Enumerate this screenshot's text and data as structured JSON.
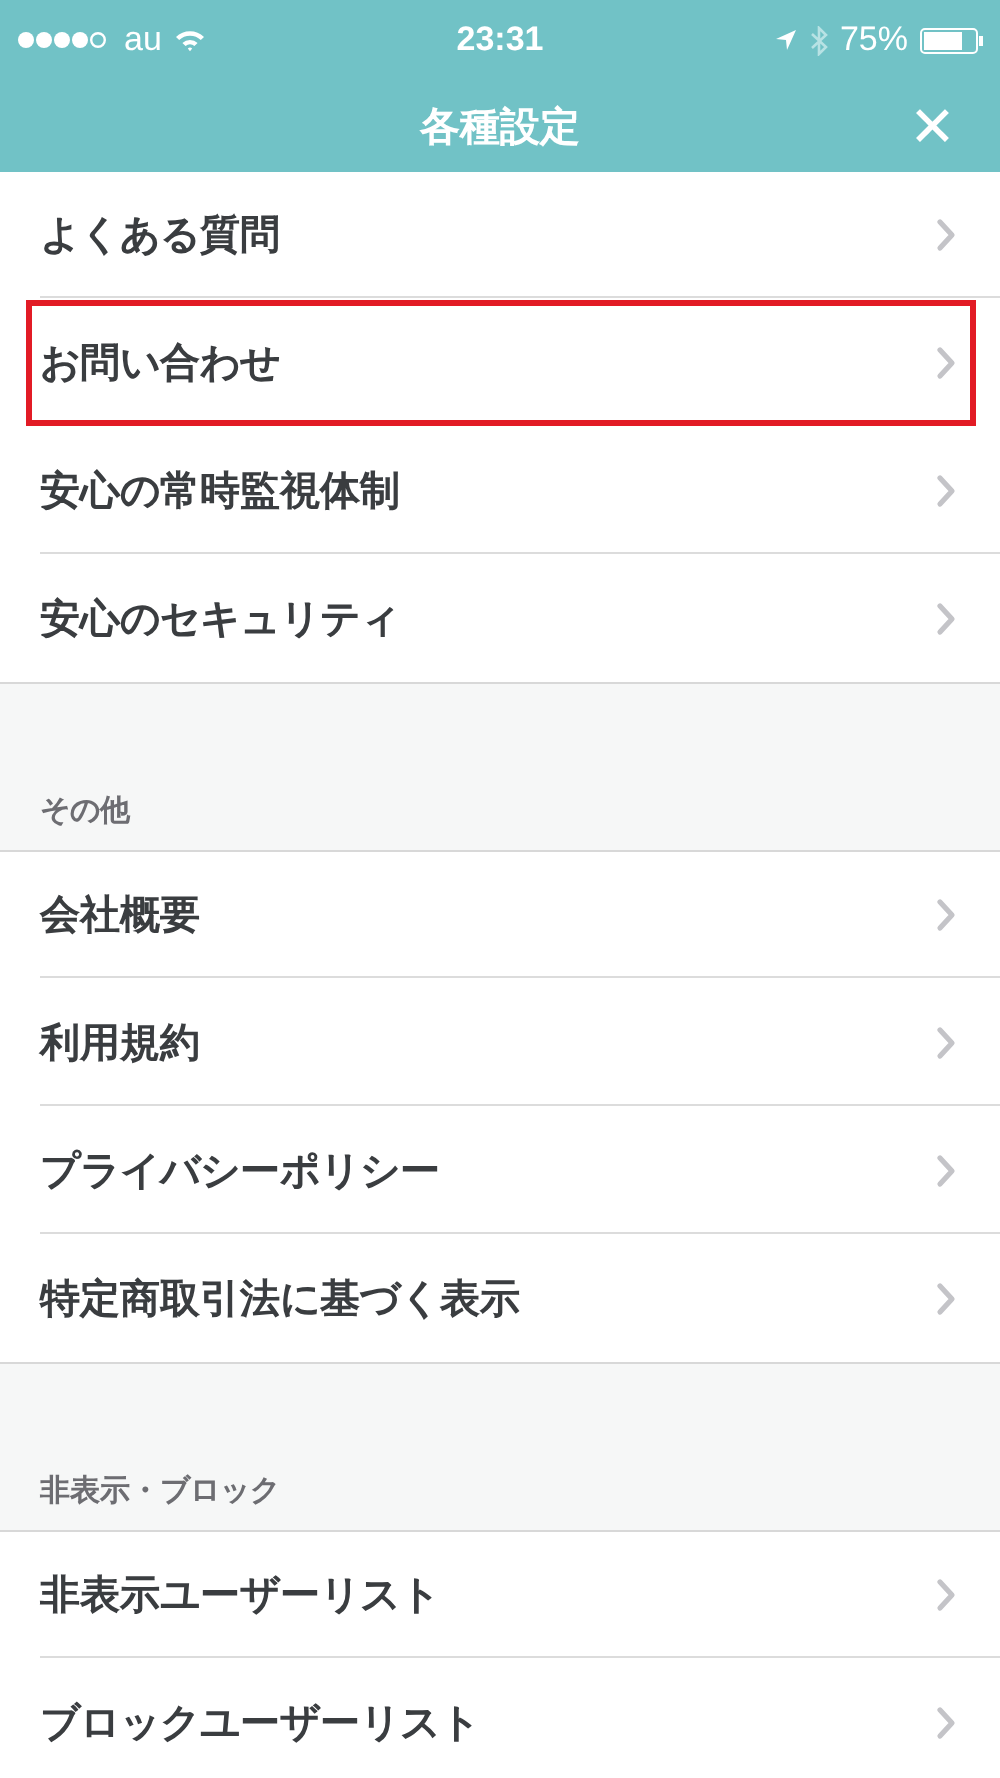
{
  "status_bar": {
    "carrier": "au",
    "time": "23:31",
    "battery": "75%"
  },
  "nav": {
    "title": "各種設定",
    "close": "✕"
  },
  "sections": [
    {
      "items": [
        {
          "label": "よくある質問",
          "highlighted": false
        },
        {
          "label": "お問い合わせ",
          "highlighted": true
        },
        {
          "label": "安心の常時監視体制",
          "highlighted": false
        },
        {
          "label": "安心のセキュリティ",
          "highlighted": false
        }
      ]
    },
    {
      "header": "その他",
      "items": [
        {
          "label": "会社概要",
          "highlighted": false
        },
        {
          "label": "利用規約",
          "highlighted": false
        },
        {
          "label": "プライバシーポリシー",
          "highlighted": false
        },
        {
          "label": "特定商取引法に基づく表示",
          "highlighted": false
        }
      ]
    },
    {
      "header": "非表示・ブロック",
      "items": [
        {
          "label": "非表示ユーザーリスト",
          "highlighted": false
        },
        {
          "label": "ブロックユーザーリスト",
          "highlighted": false
        }
      ]
    }
  ]
}
